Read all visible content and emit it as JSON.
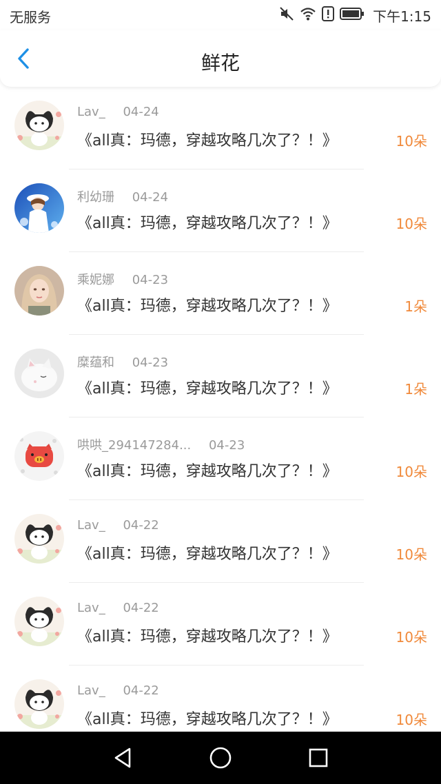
{
  "status_bar": {
    "carrier": "无服务",
    "time": "下午1:15",
    "icons": [
      "mute-icon",
      "wifi-icon",
      "alert-icon",
      "battery-icon"
    ]
  },
  "header": {
    "title": "鲜花",
    "back_icon": "chevron-left-icon"
  },
  "colors": {
    "accent": "#1e90e6",
    "count": "#f0893a",
    "meta": "#9a9a9a",
    "text": "#333333"
  },
  "rows": [
    {
      "avatar": "cat-avatar",
      "name": "Lav_",
      "date": "04-24",
      "title": "《all真：玛德，穿越攻略几次了？！》",
      "count": "10朵"
    },
    {
      "avatar": "girl-blue-avatar",
      "name": "利幼珊",
      "date": "04-24",
      "title": "《all真：玛德，穿越攻略几次了？！》",
      "count": "10朵"
    },
    {
      "avatar": "girl-photo-avatar",
      "name": "乘妮娜",
      "date": "04-23",
      "title": "《all真：玛德，穿越攻略几次了？！》",
      "count": "1朵"
    },
    {
      "avatar": "white-cat-avatar",
      "name": "糜蕴和",
      "date": "04-23",
      "title": "《all真：玛德，穿越攻略几次了？！》",
      "count": "1朵"
    },
    {
      "avatar": "pig-avatar",
      "name": "哄哄_294147284...",
      "date": "04-23",
      "title": "《all真：玛德，穿越攻略几次了？！》",
      "count": "10朵"
    },
    {
      "avatar": "cat-avatar",
      "name": "Lav_",
      "date": "04-22",
      "title": "《all真：玛德，穿越攻略几次了？！》",
      "count": "10朵"
    },
    {
      "avatar": "cat-avatar",
      "name": "Lav_",
      "date": "04-22",
      "title": "《all真：玛德，穿越攻略几次了？！》",
      "count": "10朵"
    },
    {
      "avatar": "cat-avatar",
      "name": "Lav_",
      "date": "04-22",
      "title": "《all真：玛德，穿越攻略几次了？！》",
      "count": "10朵"
    }
  ],
  "system_nav": [
    "back-triangle-icon",
    "home-circle-icon",
    "recents-square-icon"
  ]
}
